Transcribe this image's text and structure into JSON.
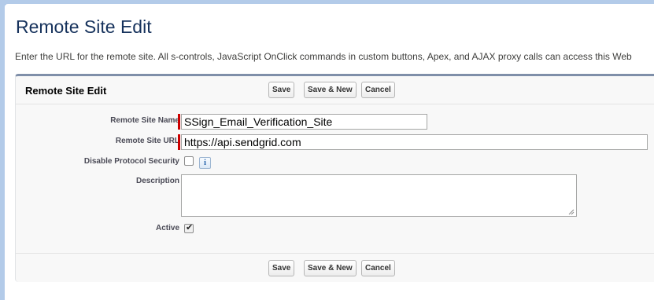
{
  "page": {
    "title": "Remote Site Edit",
    "intro": "Enter the URL for the remote site. All s-controls, JavaScript OnClick commands in custom buttons, Apex, and AJAX proxy calls can access this Web"
  },
  "block": {
    "title": "Remote Site Edit",
    "buttons": {
      "save": "Save",
      "save_new": "Save & New",
      "cancel": "Cancel"
    }
  },
  "fields": {
    "remote_site_name": {
      "label": "Remote Site Name",
      "value": "SSign_Email_Verification_Site"
    },
    "remote_site_url": {
      "label": "Remote Site URL",
      "value": "https://api.sendgrid.com"
    },
    "disable_protocol_security": {
      "label": "Disable Protocol Security",
      "checked": false,
      "info_icon_glyph": "i"
    },
    "description": {
      "label": "Description",
      "value": ""
    },
    "active": {
      "label": "Active",
      "checked": true,
      "checkmark_glyph": "✔"
    }
  },
  "colors": {
    "required_marker": "#c00000",
    "block_border": "#7f8fa9",
    "title_color": "#16325c"
  },
  "icons": {
    "info": "info-icon",
    "checkmark": "checkmark-icon",
    "resize": "resize-grip-icon"
  }
}
